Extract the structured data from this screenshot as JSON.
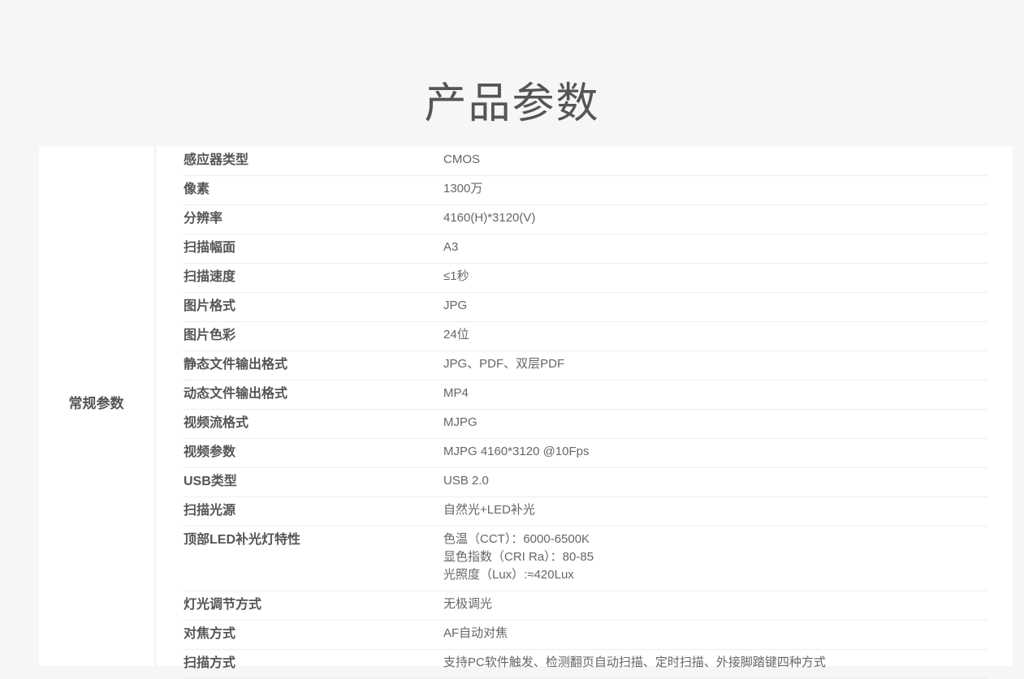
{
  "page": {
    "title": "产品参数"
  },
  "spec": {
    "category": "常规参数",
    "rows": [
      {
        "key": "感应器类型",
        "value": [
          "CMOS"
        ]
      },
      {
        "key": "像素",
        "value": [
          "1300万"
        ]
      },
      {
        "key": "分辨率",
        "value": [
          "4160(H)*3120(V)"
        ]
      },
      {
        "key": "扫描幅面",
        "value": [
          "A3"
        ]
      },
      {
        "key": "扫描速度",
        "value": [
          "≤1秒"
        ]
      },
      {
        "key": "图片格式",
        "value": [
          "JPG"
        ]
      },
      {
        "key": "图片色彩",
        "value": [
          "24位"
        ]
      },
      {
        "key": "静态文件输出格式",
        "value": [
          "JPG、PDF、双层PDF"
        ]
      },
      {
        "key": "动态文件输出格式",
        "value": [
          "MP4"
        ]
      },
      {
        "key": "视频流格式",
        "value": [
          "MJPG"
        ]
      },
      {
        "key": "视频参数",
        "value": [
          "MJPG 4160*3120 @10Fps"
        ]
      },
      {
        "key": "USB类型",
        "value": [
          "USB 2.0"
        ]
      },
      {
        "key": "扫描光源",
        "value": [
          "自然光+LED补光"
        ]
      },
      {
        "key": "顶部LED补光灯特性",
        "value": [
          "色温（CCT）：6000-6500K",
          "显色指数（CRI Ra）：80-85",
          "光照度（Lux）:≈420Lux"
        ]
      },
      {
        "key": "灯光调节方式",
        "value": [
          "无极调光"
        ]
      },
      {
        "key": "对焦方式",
        "value": [
          "AF自动对焦"
        ]
      },
      {
        "key": "扫描方式",
        "value": [
          "支持PC软件触发、检测翻页自动扫描、定时扫描、外接脚踏键四种方式"
        ]
      }
    ]
  }
}
